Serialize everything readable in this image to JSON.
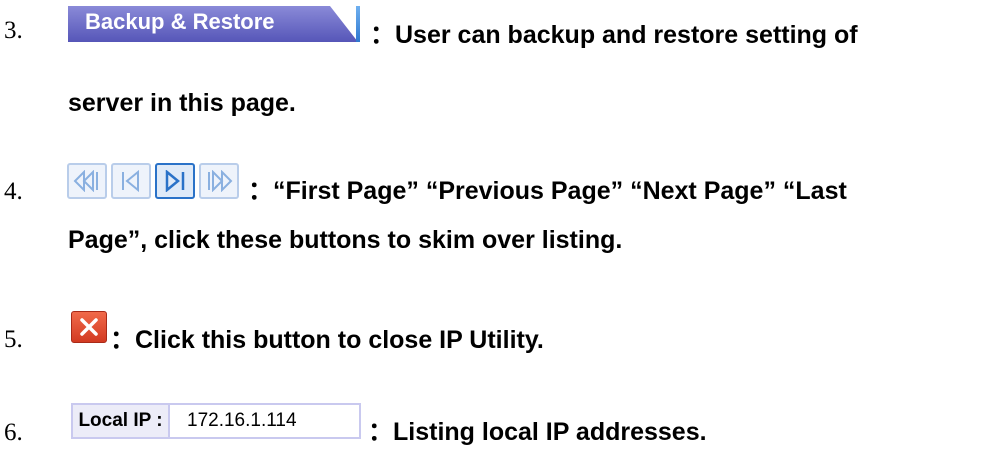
{
  "items": [
    {
      "number": "3.",
      "button_label": "Backup & Restore",
      "line1": "：User can backup and restore setting of",
      "line2": "server in this page."
    },
    {
      "number": "4.",
      "nav_buttons": [
        "first-page",
        "previous-page",
        "next-page",
        "last-page"
      ],
      "line1": "：“First Page” “Previous Page” “Next Page” “Last",
      "line2": "Page”, click these buttons to skim over listing."
    },
    {
      "number": "5.",
      "line1": "：Click this button to close IP Utility."
    },
    {
      "number": "6.",
      "field_label": "Local IP :",
      "field_value": "172.16.1.114",
      "line1": "：Listing local IP addresses."
    }
  ],
  "colors": {
    "button": "#6a6ac8",
    "nav_active": "#2a72c8",
    "close": "#e04a30"
  }
}
